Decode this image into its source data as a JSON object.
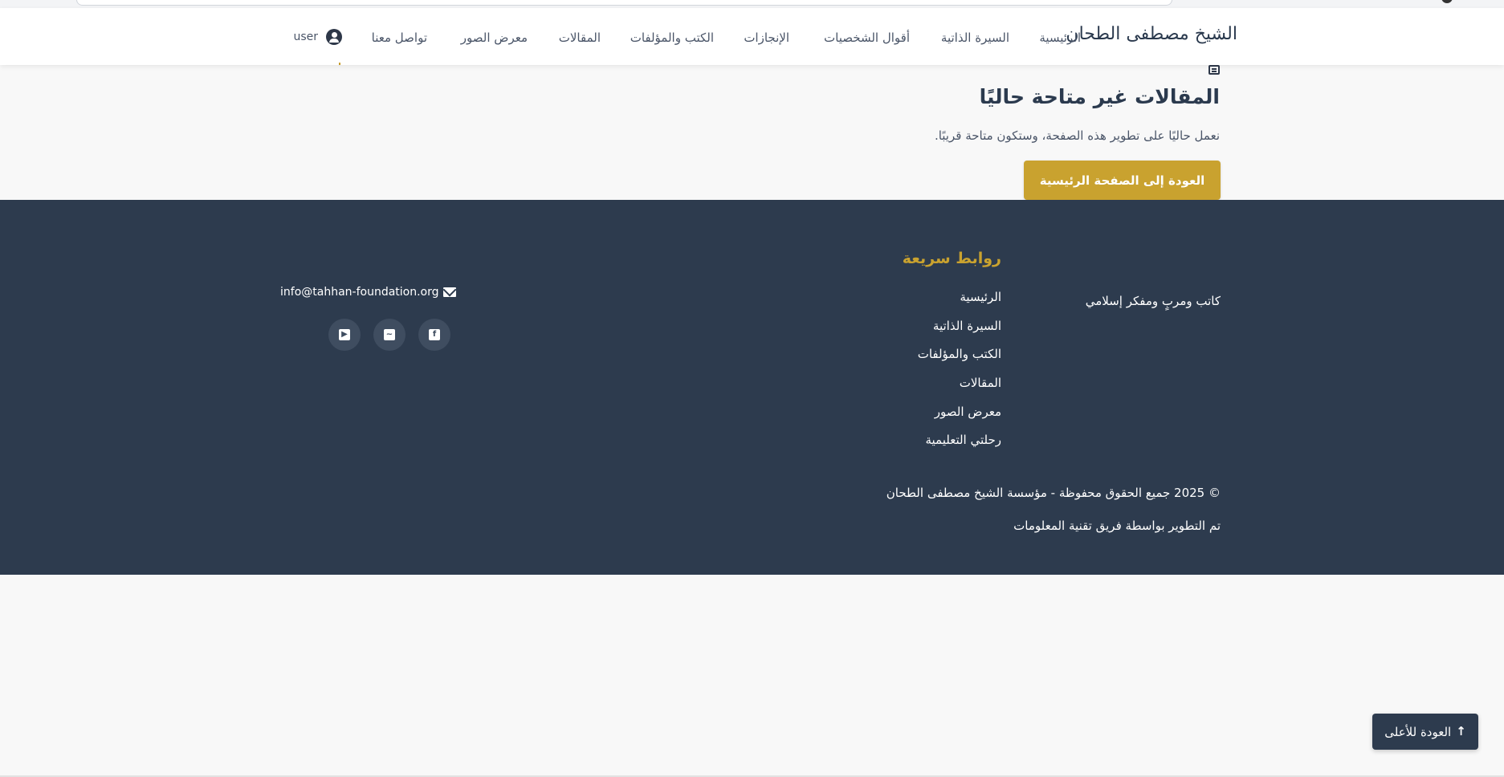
{
  "navbar": {
    "brand": "الشيخ مصطفى الطحان",
    "links": [
      {
        "label": "الرئيسية"
      },
      {
        "label": "السيرة الذاتية"
      },
      {
        "label": "أقوال الشخصيات"
      },
      {
        "label": "الإنجازات"
      },
      {
        "label": "الكتب والمؤلفات"
      },
      {
        "label": "المقالات"
      },
      {
        "label": "معرض الصور"
      },
      {
        "label": "تواصل معنا"
      }
    ],
    "user_label": "user"
  },
  "main": {
    "icon": "newspaper-icon",
    "title": "المقالات غير متاحة حاليًا",
    "subtitle": "نعمل حاليًا على تطوير هذه الصفحة، وستكون متاحة قريبًا.",
    "home_button": "العودة إلى الصفحة الرئيسية"
  },
  "footer": {
    "about": "كاتب ومربٍ ومفكر إسلامي",
    "quick_links_title": "روابط سريعة",
    "quick_links": [
      "الرئيسية",
      "السيرة الذاتية",
      "الكتب والمؤلفات",
      "المقالات",
      "معرض الصور",
      "رحلتي التعليمية"
    ],
    "email": "info@tahhan-foundation.org",
    "social": [
      "facebook-icon",
      "twitter-icon",
      "youtube-icon"
    ],
    "copyright": "© 2025 جميع الحقوق محفوظة - مؤسسة الشيخ مصطفى الطحان",
    "credit": "تم التطوير بواسطة فريق تقنية المعلومات"
  },
  "back_to_top": "العودة للأعلى",
  "colors": {
    "accent": "#c9a22f",
    "footer_bg": "#2d3b4e",
    "page_bg": "#f8f8f8"
  }
}
